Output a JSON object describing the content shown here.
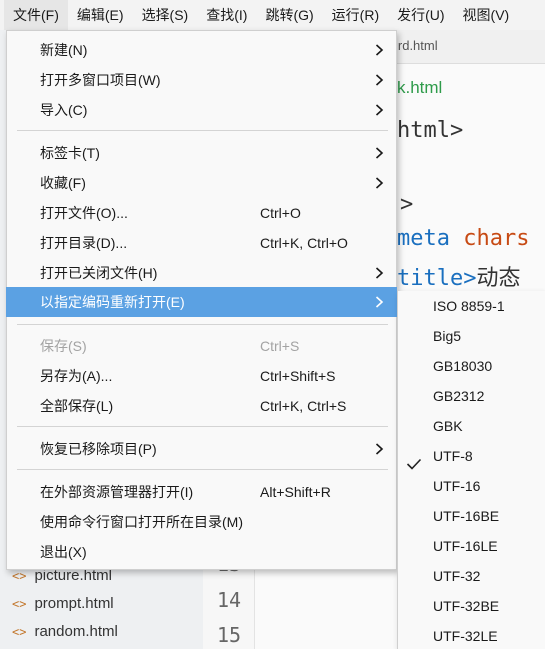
{
  "menubar": {
    "items": [
      "文件(F)",
      "编辑(E)",
      "选择(S)",
      "查找(I)",
      "跳转(G)",
      "运行(R)",
      "发行(U)",
      "视图(V)"
    ]
  },
  "editor": {
    "tab_label": "ird.html",
    "breadcrumb": "k.html",
    "code": {
      "line1": "html>",
      "line2": ">",
      "line3_tag": "meta",
      "line3_attr": "chars",
      "line4_tag": "title>",
      "line4_text": "动态"
    }
  },
  "sidebar": {
    "files": [
      "picture.html",
      "prompt.html",
      "random.html"
    ]
  },
  "gutter": {
    "lines": [
      "13",
      "14",
      "15"
    ]
  },
  "file_menu": {
    "items": [
      {
        "label": "新建(N)",
        "shortcut": "",
        "submenu": true
      },
      {
        "label": "打开多窗口项目(W)",
        "shortcut": "",
        "submenu": true
      },
      {
        "label": "导入(C)",
        "shortcut": "",
        "submenu": true
      },
      {
        "label": "标签卡(T)",
        "shortcut": "",
        "submenu": true
      },
      {
        "label": "收藏(F)",
        "shortcut": "",
        "submenu": true
      },
      {
        "label": "打开文件(O)...",
        "shortcut": "Ctrl+O",
        "submenu": false
      },
      {
        "label": "打开目录(D)...",
        "shortcut": "Ctrl+K, Ctrl+O",
        "submenu": false
      },
      {
        "label": "打开已关闭文件(H)",
        "shortcut": "",
        "submenu": true
      },
      {
        "label": "以指定编码重新打开(E)",
        "shortcut": "",
        "submenu": true,
        "highlighted": true
      },
      {
        "label": "保存(S)",
        "shortcut": "Ctrl+S",
        "submenu": false,
        "disabled": true
      },
      {
        "label": "另存为(A)...",
        "shortcut": "Ctrl+Shift+S",
        "submenu": false
      },
      {
        "label": "全部保存(L)",
        "shortcut": "Ctrl+K, Ctrl+S",
        "submenu": false
      },
      {
        "label": "恢复已移除项目(P)",
        "shortcut": "",
        "submenu": true
      },
      {
        "label": "在外部资源管理器打开(I)",
        "shortcut": "Alt+Shift+R",
        "submenu": false
      },
      {
        "label": "使用命令行窗口打开所在目录(M)",
        "shortcut": "",
        "submenu": false
      },
      {
        "label": "退出(X)",
        "shortcut": "",
        "submenu": false
      }
    ]
  },
  "encoding_submenu": {
    "items": [
      "ISO 8859-1",
      "Big5",
      "GB18030",
      "GB2312",
      "GBK",
      "UTF-8",
      "UTF-16",
      "UTF-16BE",
      "UTF-16LE",
      "UTF-32",
      "UTF-32BE",
      "UTF-32LE"
    ],
    "checked": "UTF-8"
  },
  "colors": {
    "highlight": "#5ba1e3",
    "disabled_text": "#a3a3a3",
    "tag_blue": "#1a6fbf",
    "attr_orange": "#c74a14",
    "breadcrumb_green": "#2e9b4a"
  }
}
